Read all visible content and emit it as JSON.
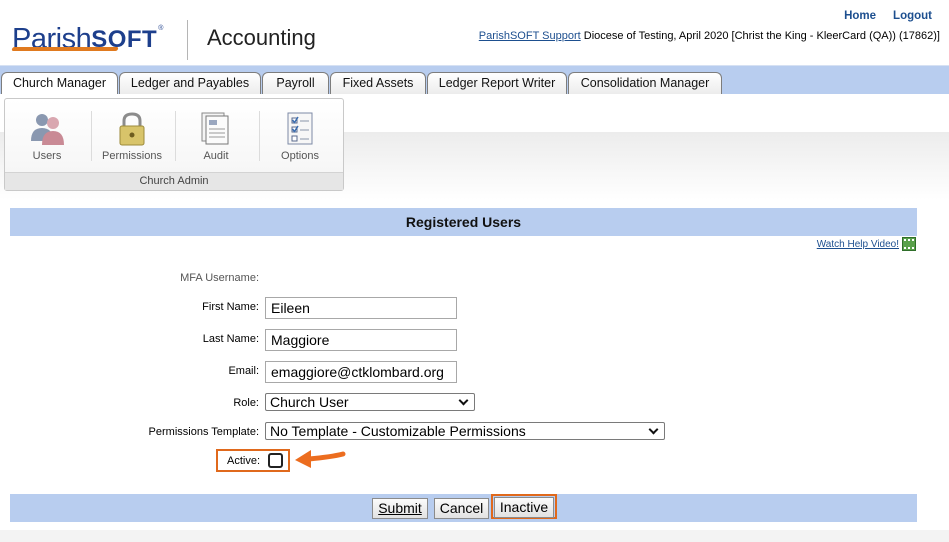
{
  "header": {
    "logo_part1": "Parish",
    "logo_part2": "SOFT",
    "logo_reg": "®",
    "app_title": "Accounting",
    "links": {
      "home": "Home",
      "logout": "Logout"
    },
    "support_link": "ParishSOFT Support",
    "context_text": "Diocese of Testing, April 2020 [Christ the King - KleerCard (QA)) (17862)]"
  },
  "tabs": [
    {
      "label": "Church Manager",
      "active": true
    },
    {
      "label": "Ledger and Payables"
    },
    {
      "label": "Payroll"
    },
    {
      "label": "Fixed Assets"
    },
    {
      "label": "Ledger Report Writer"
    },
    {
      "label": "Consolidation Manager"
    }
  ],
  "ribbon": {
    "group_label": "Church Admin",
    "buttons": [
      {
        "label": "Users",
        "icon": "users-icon"
      },
      {
        "label": "Permissions",
        "icon": "lock-icon"
      },
      {
        "label": "Audit",
        "icon": "audit-icon"
      },
      {
        "label": "Options",
        "icon": "checklist-icon"
      }
    ]
  },
  "form": {
    "section_title": "Registered Users",
    "help_link": "Watch Help Video!",
    "mfa_label": "MFA Username:",
    "first_name_label": "First Name:",
    "first_name_value": "Eileen",
    "last_name_label": "Last Name:",
    "last_name_value": "Maggiore",
    "email_label": "Email:",
    "email_value": "emaggiore@ctklombard.org",
    "role_label": "Role:",
    "role_value": "Church User",
    "template_label": "Permissions Template:",
    "template_value": "No Template - Customizable Permissions",
    "active_label": "Active:",
    "active_checked": false
  },
  "buttons": {
    "submit": "Submit",
    "cancel": "Cancel",
    "inactive": "Inactive"
  },
  "colors": {
    "accent_blue": "#b8cdef",
    "link_blue": "#1d4f8f",
    "highlight_orange": "#e0691c"
  }
}
